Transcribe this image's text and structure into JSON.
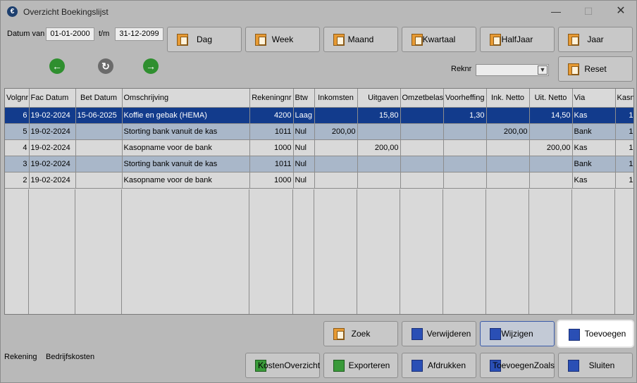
{
  "window": {
    "title": "Overzicht Boekingslijst",
    "min": "—",
    "max": "☐",
    "close": "✕"
  },
  "filter": {
    "datum_van_label": "Datum van",
    "datum_van": "01-01-2000",
    "tm_label": "t/m",
    "datum_tot": "31-12-2099",
    "reknr_label": "Reknr",
    "reknr_value": ""
  },
  "period_buttons": [
    "Dag",
    "Week",
    "Maand",
    "Kwartaal",
    "HalfJaar",
    "Jaar"
  ],
  "reset_label": "Reset",
  "nav": {
    "prev": "←",
    "refresh": "↻",
    "next": "→"
  },
  "table": {
    "columns": [
      "Volgnr",
      "Fac Datum",
      "Bet Datum",
      "Omschrijving",
      "Rekeningnr",
      "Btw",
      "Inkomsten",
      "Uitgaven",
      "Omzetbelas",
      "Voorheffing",
      "Ink. Netto",
      "Uit. Netto",
      "Via",
      "Kasnr"
    ],
    "rows": [
      [
        "6",
        "19-02-2024",
        "15-06-2025",
        "Koffie en gebak (HEMA)",
        "4200",
        "Laag",
        "",
        "15,80",
        "",
        "1,30",
        "",
        "14,50",
        "Kas",
        "1"
      ],
      [
        "5",
        "19-02-2024",
        "",
        "Storting bank vanuit de kas",
        "1011",
        "Nul",
        "200,00",
        "",
        "",
        "",
        "200,00",
        "",
        "Bank",
        "1"
      ],
      [
        "4",
        "19-02-2024",
        "",
        "Kasopname voor de bank",
        "1000",
        "Nul",
        "",
        "200,00",
        "",
        "",
        "",
        "200,00",
        "Kas",
        "1"
      ],
      [
        "3",
        "19-02-2024",
        "",
        "Storting bank vanuit de kas",
        "1011",
        "Nul",
        "",
        "",
        "",
        "",
        "",
        "",
        "Bank",
        "1"
      ],
      [
        "2",
        "19-02-2024",
        "",
        "Kasopname voor de bank",
        "1000",
        "Nul",
        "",
        "",
        "",
        "",
        "",
        "",
        "Kas",
        "1"
      ]
    ]
  },
  "actions": {
    "zoek": "Zoek",
    "verwijderen": "Verwijderen",
    "wijzigen": "Wijzigen",
    "toevoegen": "Toevoegen",
    "kosten_overzicht_1": "Kosten",
    "kosten_overzicht_2": "Overzicht",
    "exporteren": "Exporteren",
    "afdrukken": "Afdrukken",
    "toevoegen_zoals_1": "Toevoegen",
    "toevoegen_zoals_2": "Zoals",
    "sluiten": "Sluiten"
  },
  "status": {
    "rekening_label": "Rekening",
    "rekening_value": "Bedrijfskosten"
  },
  "colors": {
    "selected_row": "#123b8c",
    "alt_row": "#a9b7c9",
    "accent": "#3a5aa7"
  }
}
